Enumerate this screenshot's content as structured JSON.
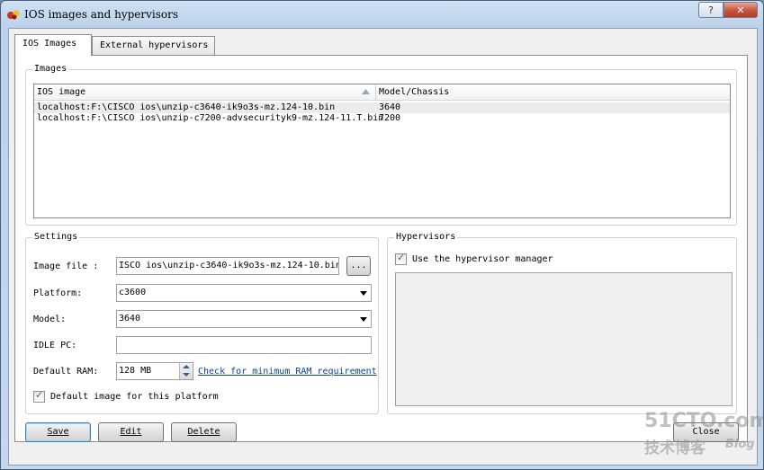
{
  "window": {
    "title": "IOS images and hypervisors",
    "help_label": "?",
    "close_label": "✕"
  },
  "tabs": [
    {
      "label": "IOS Images",
      "active": true
    },
    {
      "label": "External hypervisors",
      "active": false
    }
  ],
  "images_group": {
    "label": "Images",
    "columns": [
      "IOS image",
      "Model/Chassis"
    ],
    "sort_icon": "sort-ascending-icon",
    "rows": [
      {
        "image": "localhost:F:\\CISCO ios\\unzip-c3640-ik9o3s-mz.124-10.bin",
        "model": "3640"
      },
      {
        "image": "localhost:F:\\CISCO ios\\unzip-c7200-advsecurityk9-mz.124-11.T.bin",
        "model": "7200"
      }
    ]
  },
  "settings": {
    "label": "Settings",
    "image_file_label": "Image file :",
    "image_file_value": "ISCO ios\\unzip-c3640-ik9o3s-mz.124-10.bin",
    "browse_label": "...",
    "platform_label": "Platform:",
    "platform_value": "c3600",
    "model_label": "Model:",
    "model_value": "3640",
    "idle_pc_label": "IDLE PC:",
    "idle_pc_value": "",
    "default_ram_label": "Default RAM:",
    "default_ram_value": "128 MB",
    "ram_link": "Check for minimum RAM requirement",
    "default_image_label": "Default image for this platform",
    "default_image_checked": true
  },
  "hypervisors": {
    "label": "Hypervisors",
    "use_manager_label": "Use the hypervisor manager",
    "use_manager_checked": true
  },
  "buttons": {
    "save": "Save",
    "edit": "Edit",
    "delete": "Delete",
    "close": "Close"
  },
  "watermark": {
    "line1": "51CTO.com",
    "line2": "技术博客",
    "line3": "Blog"
  },
  "colors": {
    "titlebar": "#c4d7ec",
    "link": "#0a3fa0",
    "close_button": "#c8543c"
  }
}
